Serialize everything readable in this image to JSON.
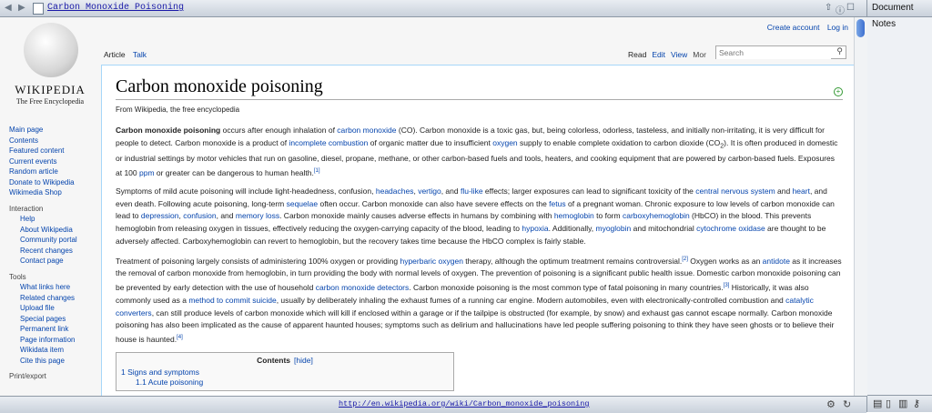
{
  "browser": {
    "tab_title": "Carbon Monoxide Poisoning",
    "status_url": "http://en.wikipedia.org/wiki/Carbon_monoxide_poisoning",
    "notes_title": "Document Notes"
  },
  "wiki": {
    "wordmark": "WIKIPEDIA",
    "tagline": "The Free Encyclopedia",
    "personal": {
      "create_account": "Create account",
      "login": "Log in"
    },
    "tabs_left": [
      "Article",
      "Talk"
    ],
    "tabs_right": [
      "Read",
      "Edit",
      "View",
      "Mor"
    ],
    "search_placeholder": "Search",
    "sidebar": {
      "main": [
        "Main page",
        "Contents",
        "Featured content",
        "Current events",
        "Random article",
        "Donate to Wikipedia",
        "Wikimedia Shop"
      ],
      "interaction_title": "Interaction",
      "interaction": [
        "Help",
        "About Wikipedia",
        "Community portal",
        "Recent changes",
        "Contact page"
      ],
      "tools_title": "Tools",
      "tools": [
        "What links here",
        "Related changes",
        "Upload file",
        "Special pages",
        "Permanent link",
        "Page information",
        "Wikidata item",
        "Cite this page"
      ],
      "print_title": "Print/export"
    }
  },
  "article": {
    "title": "Carbon monoxide poisoning",
    "from": "From Wikipedia, the free encyclopedia",
    "p1": {
      "bold": "Carbon monoxide poisoning",
      "t1": " occurs after enough inhalation of ",
      "l1": "carbon monoxide",
      "t2": " (CO). Carbon monoxide is a toxic gas, but, being colorless, odorless, tasteless, and initially non-irritating, it is very difficult for people to detect. Carbon monoxide is a product of ",
      "l2": "incomplete combustion",
      "t3": " of organic matter due to insufficient ",
      "l3": "oxygen",
      "t4": " supply to enable complete oxidation to carbon dioxide (CO",
      "sub": "2",
      "t5": "). It is often produced in domestic or industrial settings by motor vehicles that run on gasoline, diesel, propane, methane, or other carbon-based fuels and tools, heaters, and cooking equipment that are powered by carbon-based fuels. Exposures at 100 ",
      "l4": "ppm",
      "t6": " or greater can be dangerous to human health.",
      "ref": "[1]"
    },
    "p2": {
      "t1": "Symptoms of mild acute poisoning will include light-headedness, confusion, ",
      "l1": "headaches",
      "t2": ", ",
      "l2": "vertigo",
      "t3": ", and ",
      "l3": "flu-like",
      "t4": " effects; larger exposures can lead to significant toxicity of the ",
      "l4": "central nervous system",
      "t5": " and ",
      "l5": "heart",
      "t6": ", and even death. Following acute poisoning, long-term ",
      "l6": "sequelae",
      "t7": " often occur. Carbon monoxide can also have severe effects on the ",
      "l7": "fetus",
      "t8": " of a pregnant woman. Chronic exposure to low levels of carbon monoxide can lead to ",
      "l8": "depression",
      "t9": ", ",
      "l9": "confusion",
      "t10": ", and ",
      "l10": "memory loss",
      "t11": ". Carbon monoxide mainly causes adverse effects in humans by combining with ",
      "l11": "hemoglobin",
      "t12": " to form ",
      "l12": "carboxyhemoglobin",
      "t13": " (HbCO) in the blood. This prevents hemoglobin from releasing oxygen in tissues, effectively reducing the oxygen-carrying capacity of the blood, leading to ",
      "l13": "hypoxia",
      "t14": ". Additionally, ",
      "l14": "myoglobin",
      "t15": " and mitochondrial ",
      "l15": "cytochrome oxidase",
      "t16": " are thought to be adversely affected. Carboxyhemoglobin can revert to hemoglobin, but the recovery takes time because the HbCO complex is fairly stable."
    },
    "p3": {
      "t1": "Treatment of poisoning largely consists of administering 100% oxygen or providing ",
      "l1": "hyperbaric oxygen",
      "t2": " therapy, although the optimum treatment remains controversial.",
      "r1": "[2]",
      "t3": " Oxygen works as an ",
      "l2": "antidote",
      "t4": " as it increases the removal of carbon monoxide from hemoglobin, in turn providing the body with normal levels of oxygen. The prevention of poisoning is a significant public health issue. Domestic carbon monoxide poisoning can be prevented by early detection with the use of household ",
      "l3": "carbon monoxide detectors",
      "t5": ". Carbon monoxide poisoning is the most common type of fatal poisoning in many countries.",
      "r2": "[3]",
      "t6": " Historically, it was also commonly used as a ",
      "l4": "method to commit suicide",
      "t7": ", usually by deliberately inhaling the exhaust fumes of a running car engine. Modern automobiles, even with electronically-controlled combustion and ",
      "l5": "catalytic converters",
      "t8": ", can still produce levels of carbon monoxide which will kill if enclosed within a garage or if the tailpipe is obstructed (for example, by snow) and exhaust gas cannot escape normally. Carbon monoxide poisoning has also been implicated as the cause of apparent haunted houses; symptoms such as delirium and hallucinations have led people suffering poisoning to think they have seen ghosts or to believe their house is haunted.",
      "r3": "[4]"
    },
    "toc": {
      "title": "Contents",
      "hide": "[hide]",
      "item1": "1 Signs and symptoms",
      "item1_1": "1.1 Acute poisoning"
    }
  }
}
